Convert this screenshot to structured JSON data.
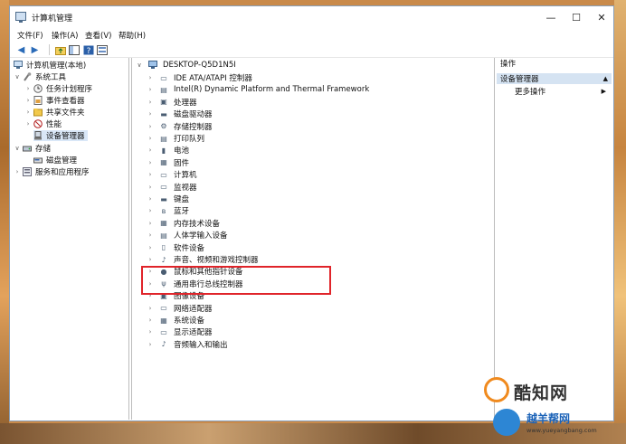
{
  "window": {
    "title": "计算机管理"
  },
  "menu": [
    "文件(F)",
    "操作(A)",
    "查看(V)",
    "帮助(H)"
  ],
  "tree": [
    {
      "label": "计算机管理(本地)",
      "icon": "computer-management-icon",
      "expander": "",
      "indent": 0
    },
    {
      "label": "系统工具",
      "icon": "tools-icon",
      "expander": "∨",
      "indent": 1
    },
    {
      "label": "任务计划程序",
      "icon": "clock-icon",
      "expander": "›",
      "indent": 2
    },
    {
      "label": "事件查看器",
      "icon": "event-viewer-icon",
      "expander": "›",
      "indent": 2
    },
    {
      "label": "共享文件夹",
      "icon": "shared-folder-icon",
      "expander": "›",
      "indent": 2
    },
    {
      "label": "性能",
      "icon": "performance-icon",
      "expander": "›",
      "indent": 2
    },
    {
      "label": "设备管理器",
      "icon": "device-manager-icon",
      "expander": "",
      "indent": 2,
      "selected": true
    },
    {
      "label": "存储",
      "icon": "storage-icon",
      "expander": "∨",
      "indent": 1
    },
    {
      "label": "磁盘管理",
      "icon": "disk-management-icon",
      "expander": "",
      "indent": 2
    },
    {
      "label": "服务和应用程序",
      "icon": "services-icon",
      "expander": "›",
      "indent": 1
    }
  ],
  "devices": {
    "root": "DESKTOP-Q5D1N5I",
    "items": [
      {
        "label": "IDE ATA/ATAPI 控制器",
        "icon": "ide-controller-icon"
      },
      {
        "label": "Intel(R) Dynamic Platform and Thermal Framework",
        "icon": "thermal-framework-icon"
      },
      {
        "label": "处理器",
        "icon": "processor-icon"
      },
      {
        "label": "磁盘驱动器",
        "icon": "disk-drive-icon"
      },
      {
        "label": "存储控制器",
        "icon": "storage-controller-icon"
      },
      {
        "label": "打印队列",
        "icon": "printer-icon"
      },
      {
        "label": "电池",
        "icon": "battery-icon"
      },
      {
        "label": "固件",
        "icon": "firmware-icon"
      },
      {
        "label": "计算机",
        "icon": "computer-icon"
      },
      {
        "label": "监视器",
        "icon": "monitor-icon"
      },
      {
        "label": "键盘",
        "icon": "keyboard-icon"
      },
      {
        "label": "蓝牙",
        "icon": "bluetooth-icon"
      },
      {
        "label": "内存技术设备",
        "icon": "memory-device-icon"
      },
      {
        "label": "人体学输入设备",
        "icon": "hid-icon"
      },
      {
        "label": "软件设备",
        "icon": "software-device-icon"
      },
      {
        "label": "声音、视频和游戏控制器",
        "icon": "sound-icon"
      },
      {
        "label": "鼠标和其他指针设备",
        "icon": "mouse-icon"
      },
      {
        "label": "通用串行总线控制器",
        "icon": "usb-icon"
      },
      {
        "label": "图像设备",
        "icon": "camera-icon"
      },
      {
        "label": "网络适配器",
        "icon": "network-adapter-icon"
      },
      {
        "label": "系统设备",
        "icon": "system-device-icon"
      },
      {
        "label": "显示适配器",
        "icon": "display-adapter-icon"
      },
      {
        "label": "音频输入和输出",
        "icon": "audio-io-icon"
      }
    ]
  },
  "actions": {
    "header": "操作",
    "section": "设备管理器",
    "more": "更多操作"
  },
  "watermarks": {
    "brand1": "酷知网",
    "brand2": "越羊帮网",
    "url": "www.yueyangbang.com"
  },
  "colors": {
    "selection": "#d9e7f7",
    "actions_section": "#d5e3f2",
    "highlight": "#e0242a"
  }
}
